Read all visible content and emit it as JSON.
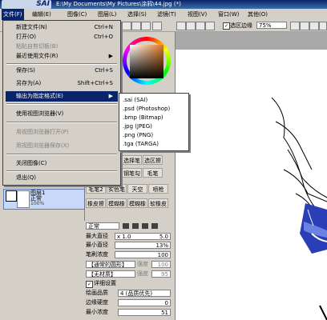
{
  "title": {
    "logo": "SAI",
    "text": "E:\\My Documents\\My Pictures\\涂鸦\\44.jpg (*)"
  },
  "menubar": [
    {
      "label": "文件(F)"
    },
    {
      "label": "编辑(E)"
    },
    {
      "label": "图像(C)"
    },
    {
      "label": "图层(L)"
    },
    {
      "label": "选择(S)"
    },
    {
      "label": "滤镜(T)"
    },
    {
      "label": "视图(V)"
    },
    {
      "label": "窗口(W)"
    },
    {
      "label": "其他(O)"
    }
  ],
  "toolbar": {
    "stabilizer_label": "选区边缘",
    "zoom": "75%"
  },
  "file_menu": {
    "items": [
      {
        "label": "新建文件(N)",
        "shortcut": "Ctrl+N",
        "disabled": false
      },
      {
        "label": "打开(O)",
        "shortcut": "Ctrl+O",
        "disabled": false
      },
      {
        "label": "粘贴自剪切板(B)",
        "shortcut": "",
        "disabled": true
      },
      {
        "label": "最近使用文件(R)",
        "shortcut": "",
        "disabled": false,
        "arrow": "▶"
      },
      {
        "label": "保存(S)",
        "shortcut": "Ctrl+S",
        "disabled": false
      },
      {
        "label": "另存为(A)",
        "shortcut": "Shift+Ctrl+S",
        "disabled": false
      },
      {
        "label": "输出为指定格式(E)",
        "shortcut": "",
        "disabled": false,
        "arrow": "▶",
        "highlighted": true
      },
      {
        "label": "使用视图浏览器(V)",
        "shortcut": "",
        "disabled": false
      },
      {
        "label": "用视图浏览器打开(P)",
        "shortcut": "",
        "disabled": true
      },
      {
        "label": "用视图浏览器保存(X)",
        "shortcut": "",
        "disabled": true
      },
      {
        "label": "关闭图像(C)",
        "shortcut": "",
        "disabled": false
      },
      {
        "label": "退出(Q)",
        "shortcut": "",
        "disabled": false
      }
    ]
  },
  "export_submenu": [
    ".sai (SAI)",
    ".psd (Photoshop)",
    ".bmp (Bitmap)",
    ".jpg (JPEG)",
    ".png (PNG)",
    ".tga (TARGA)"
  ],
  "tools": [
    "选择笔",
    "选区擦",
    "钢笔勾",
    "毛笔",
    "毛笔2",
    "实色笔",
    "天空",
    "喷枪",
    "橡皮擦",
    "模糊橡",
    "模糊橡",
    "软橡皮"
  ],
  "layer": {
    "name": "图层1",
    "mode": "正常",
    "opacity": "100%"
  },
  "brush_settings": {
    "blend_mode": "正常",
    "max_size_label": "最大直径",
    "max_size_multiplier": "x 1.0",
    "max_size_value": "5.0",
    "min_size_label": "最小直径",
    "min_size_value": "13%",
    "density_label": "笔刷浓度",
    "density_value": "100",
    "shape_label": "【通常的圆形】",
    "shape_strength_label": "强度",
    "shape_strength_value": "100",
    "texture_label": "【无材质】",
    "texture_strength_label": "强度",
    "texture_strength_value": "95",
    "detail_label": "详细设置",
    "detail_checked": "✓",
    "quality_label": "绘画品质",
    "quality_value": "4 (品质优先)",
    "edge_label": "边缘硬度",
    "edge_value": "0",
    "min_density_label": "最小浓度",
    "min_density_value": "51"
  }
}
